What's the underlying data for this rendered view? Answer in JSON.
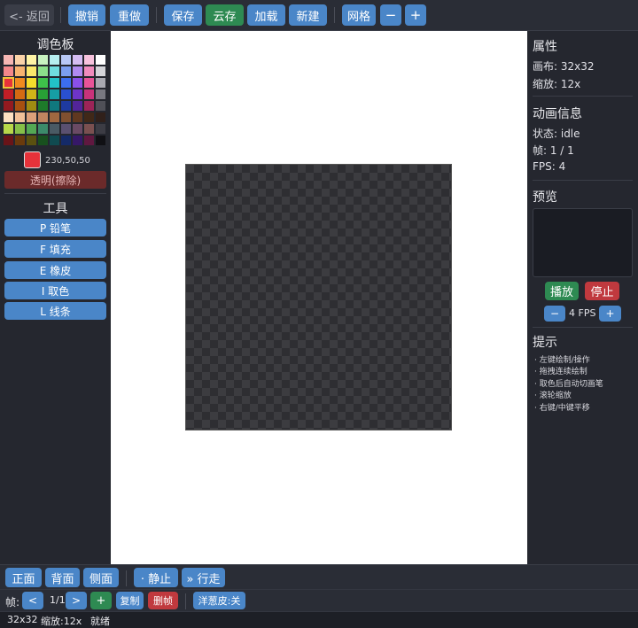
{
  "toolbar": {
    "back": "<- 返回",
    "undo": "撤销",
    "redo": "重做",
    "save": "保存",
    "cloud_save": "云存",
    "load": "加载",
    "new": "新建",
    "grid": "网格",
    "zoom_out": "−",
    "zoom_in": "+"
  },
  "left": {
    "palette_title": "调色板",
    "palette": [
      "#f6b6b3",
      "#fbd3a8",
      "#fff4a6",
      "#c8f2c0",
      "#b6eef0",
      "#b8c8f6",
      "#d5bdf3",
      "#f7c2dd",
      "#ffffff",
      "#f4878a",
      "#f8b36f",
      "#fbe86b",
      "#8be08a",
      "#6fdde0",
      "#7b9ef0",
      "#b08af0",
      "#f08bbc",
      "#d4d4d8",
      "#e6323a",
      "#f08a1f",
      "#f4dc2c",
      "#3ec24a",
      "#22c2c8",
      "#3c6ef0",
      "#8a50e8",
      "#e85498",
      "#a8a8b0",
      "#c21e26",
      "#d46a12",
      "#d0b418",
      "#28a036",
      "#169ea4",
      "#2a50d0",
      "#6e34c8",
      "#c8337a",
      "#787880",
      "#941a1f",
      "#a85010",
      "#a08c12",
      "#1e7a2a",
      "#10787e",
      "#1e3aa0",
      "#52249a",
      "#9c2458",
      "#505058",
      "#fbe0c2",
      "#f0c098",
      "#dca07a",
      "#c08460",
      "#a06840",
      "#805030",
      "#603820",
      "#402818",
      "#30201a",
      "#b8d84a",
      "#86c048",
      "#54a854",
      "#3c8a6a",
      "#4a5a64",
      "#5a5070",
      "#6a4a64",
      "#7a5050",
      "#3c3c44",
      "#6a1418",
      "#6a3a0c",
      "#5a5010",
      "#18501e",
      "#104a50",
      "#142a68",
      "#361868",
      "#601840",
      "#101014"
    ],
    "selected_index": 18,
    "current_color": "#e6323a",
    "rgb": "230,50,50",
    "transparent": "透明(擦除)",
    "tools_title": "工具",
    "tools": [
      "P 铅笔",
      "F 填充",
      "E 橡皮",
      "I 取色",
      "L 线条"
    ]
  },
  "right": {
    "props_title": "属性",
    "canvas_size": "画布: 32x32",
    "zoom": "缩放: 12x",
    "anim_title": "动画信息",
    "state": "状态: idle",
    "frame": "帧: 1 / 1",
    "fps": "FPS: 4",
    "preview_title": "预览",
    "play": "播放",
    "stop": "停止",
    "fps_minus": "−",
    "fps_label": "4 FPS",
    "fps_plus": "+",
    "tips_title": "提示",
    "tips": [
      "· 左键绘制/操作",
      "· 拖拽连续绘制",
      "· 取色后自动切画笔",
      "· 滚轮缩放",
      "· 右键/中键平移"
    ]
  },
  "bottom": {
    "front": "正面",
    "back": "背面",
    "side": "侧面",
    "idle": "· 静止",
    "walk": "» 行走",
    "frame_label": "帧:",
    "prev": "<",
    "frame_count": "1/1",
    "next": ">",
    "add": "+",
    "copy": "复制",
    "delete": "删帧",
    "onion": "洋葱皮:关"
  },
  "status": {
    "size": "32x32",
    "zoom": "缩放:12x",
    "state": "就绪"
  }
}
